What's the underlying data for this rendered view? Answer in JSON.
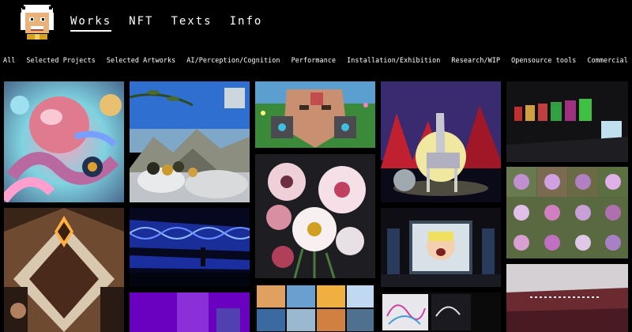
{
  "main_nav": [
    "Works",
    "NFT",
    "Texts",
    "Info"
  ],
  "categories": [
    "All",
    "Selected Projects",
    "Selected Artworks",
    "AI/Perception/Cognition",
    "Performance",
    "Installation/Exhibition",
    "Research/WIP",
    "Opensource tools",
    "Commercial"
  ],
  "colors": {
    "background": "#000000",
    "text": "#ffffff"
  },
  "artworks": [
    "octopus-artwork",
    "olive-landscape-artwork",
    "cyborg-face-artwork",
    "giraffe-moon-artwork",
    "gallery-screens-artwork",
    "flowers-bouquet-artwork",
    "flower-grid-artwork",
    "diamond-room-artwork",
    "blue-wave-installation-artwork",
    "performance-stage-artwork",
    "desert-field-artwork",
    "purple-screen-artwork",
    "landscape-panels-artwork",
    "line-drawing-artwork"
  ]
}
